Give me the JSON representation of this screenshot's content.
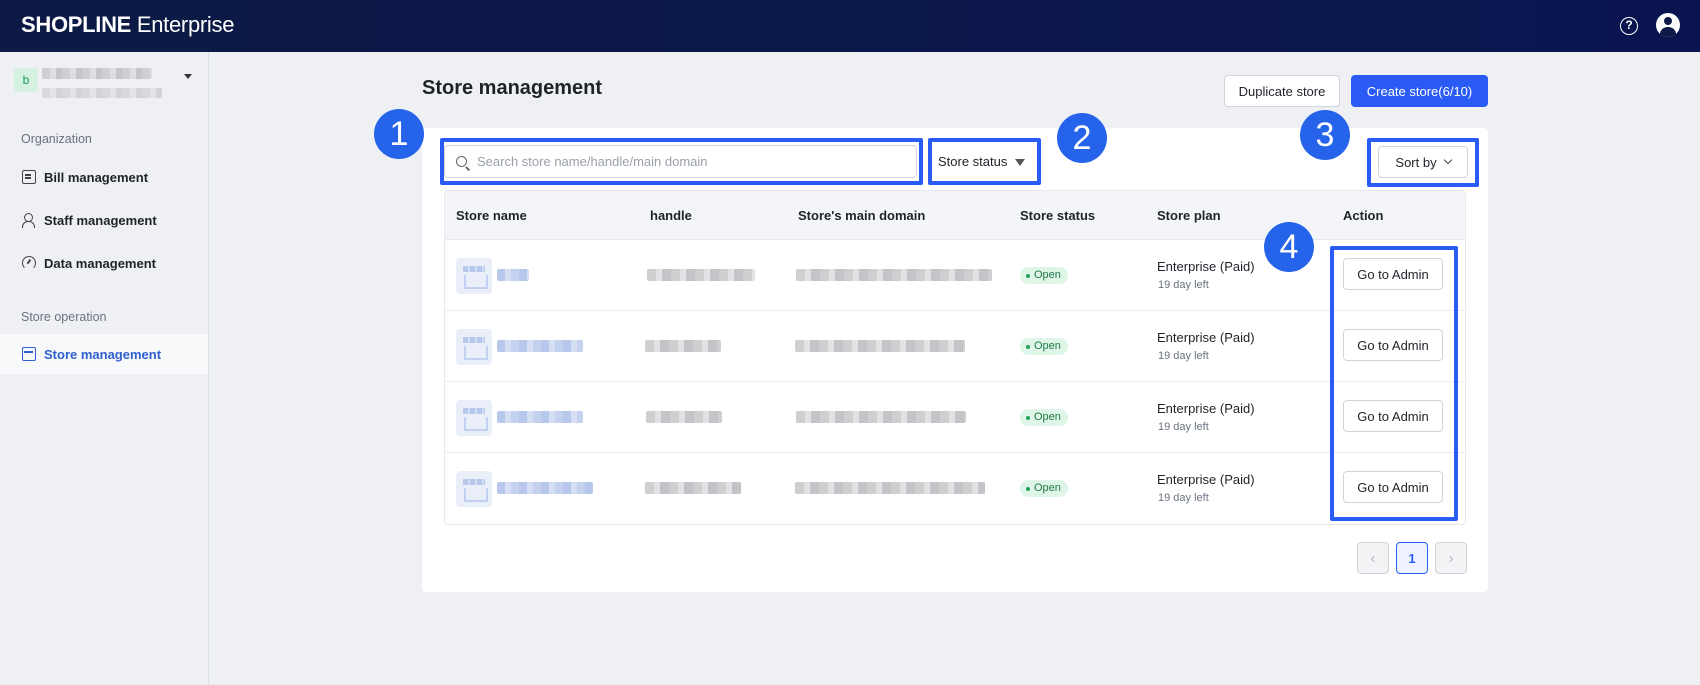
{
  "header": {
    "logo_main": "SHOPLINE",
    "logo_suffix": "Enterprise"
  },
  "sidebar": {
    "account_initial": "b",
    "section_org": "Organization",
    "section_store": "Store operation",
    "items": [
      {
        "label": "Bill management"
      },
      {
        "label": "Staff management"
      },
      {
        "label": "Data management"
      },
      {
        "label": "Store management"
      }
    ]
  },
  "main": {
    "title": "Store management",
    "duplicate_label": "Duplicate store",
    "create_label": "Create store(6/10)",
    "search_placeholder": "Search store name/handle/main domain",
    "status_filter_label": "Store status",
    "sort_label": "Sort by",
    "columns": [
      "Store name",
      "handle",
      "Store's main domain",
      "Store status",
      "Store plan",
      "Action"
    ],
    "rows": [
      {
        "status": "Open",
        "plan": "Enterprise (Paid)",
        "days": "19 day left",
        "action": "Go to Admin"
      },
      {
        "status": "Open",
        "plan": "Enterprise (Paid)",
        "days": "19 day left",
        "action": "Go to Admin"
      },
      {
        "status": "Open",
        "plan": "Enterprise (Paid)",
        "days": "19 day left",
        "action": "Go to Admin"
      },
      {
        "status": "Open",
        "plan": "Enterprise (Paid)",
        "days": "19 day left",
        "action": "Go to Admin"
      }
    ],
    "pagination": {
      "prev": "‹",
      "current": "1",
      "next": "›"
    }
  },
  "markers": [
    "1",
    "2",
    "3",
    "4"
  ],
  "colors": {
    "accent": "#2a5bf5",
    "topbar": "#0c1a45",
    "open_badge": "#dff5e8"
  }
}
